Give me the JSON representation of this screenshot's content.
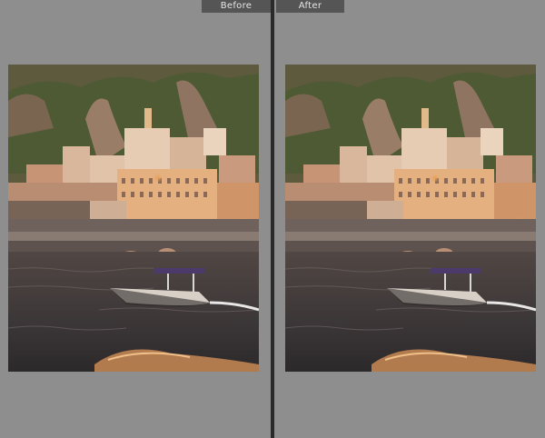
{
  "compare_view": {
    "before_label": "Before",
    "after_label": "After",
    "photo_icon": "coastal-village-photo",
    "colors": {
      "background": "#8e8e8e",
      "divider": "#2a2a2a",
      "label_bg": "#555555",
      "label_text": "#e6e6e6"
    }
  }
}
